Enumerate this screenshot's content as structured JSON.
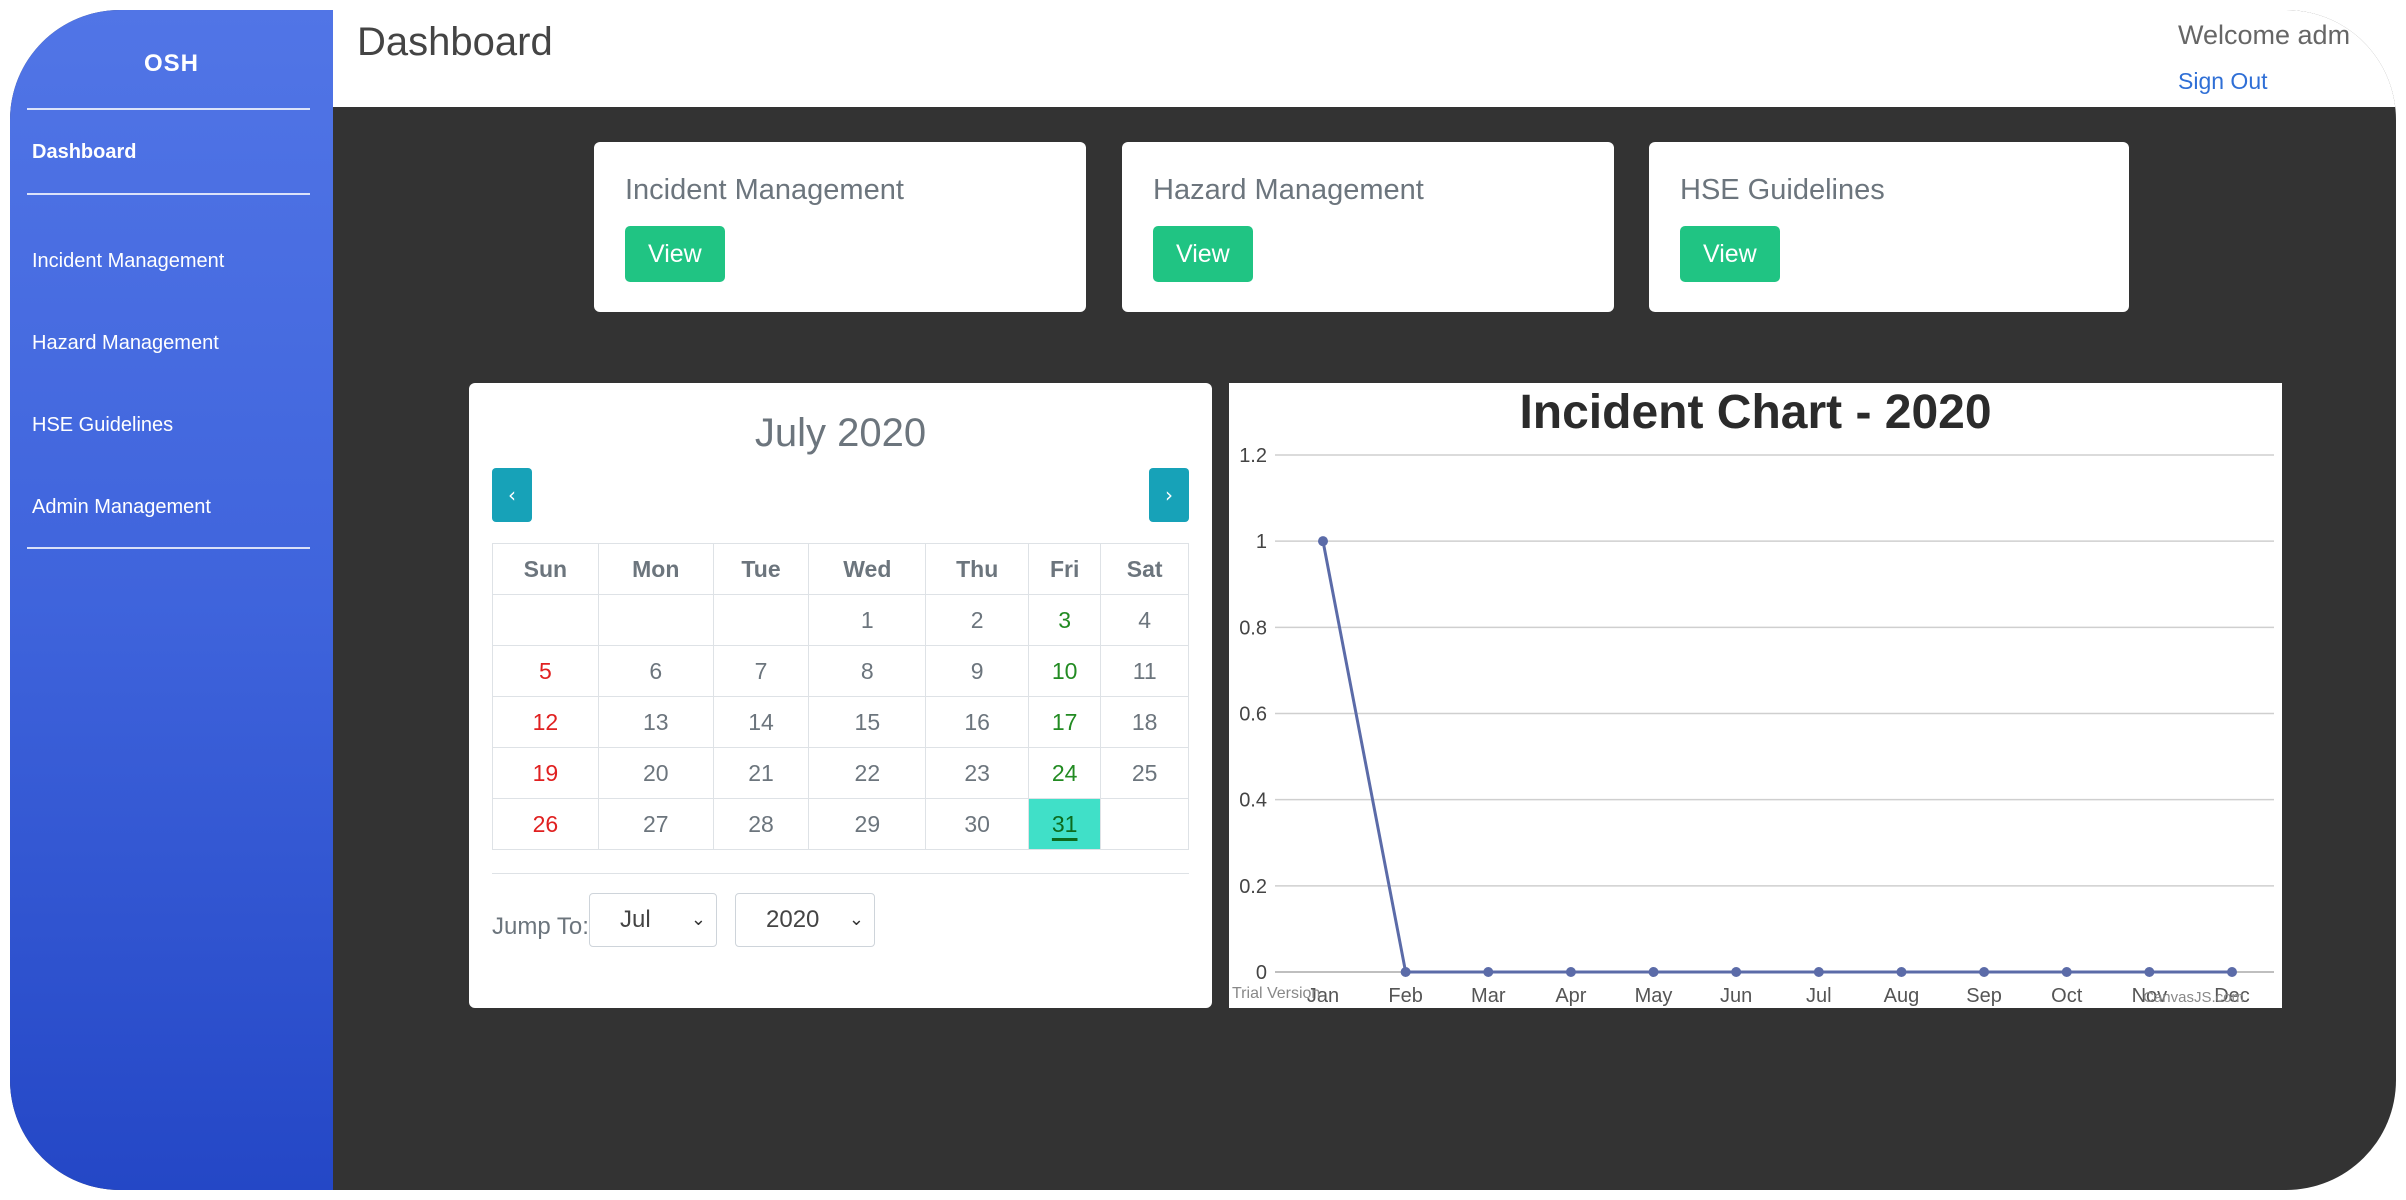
{
  "sidebar": {
    "brand": "OSH",
    "items": [
      {
        "label": "Dashboard"
      },
      {
        "label": "Incident Management"
      },
      {
        "label": "Hazard Management"
      },
      {
        "label": "HSE Guidelines"
      },
      {
        "label": "Admin Management"
      }
    ]
  },
  "header": {
    "title": "Dashboard",
    "welcome": "Welcome adm",
    "sign_out": "Sign Out"
  },
  "cards": [
    {
      "title": "Incident Management",
      "button": "View"
    },
    {
      "title": "Hazard Management",
      "button": "View"
    },
    {
      "title": "HSE Guidelines",
      "button": "View"
    }
  ],
  "calendar": {
    "title": "July 2020",
    "prev": "‹",
    "next": "›",
    "weekdays": [
      "Sun",
      "Mon",
      "Tue",
      "Wed",
      "Thu",
      "Fri",
      "Sat"
    ],
    "weeks": [
      [
        "",
        "",
        "",
        "1",
        "2",
        "3",
        "4"
      ],
      [
        "5",
        "6",
        "7",
        "8",
        "9",
        "10",
        "11"
      ],
      [
        "12",
        "13",
        "14",
        "15",
        "16",
        "17",
        "18"
      ],
      [
        "19",
        "20",
        "21",
        "22",
        "23",
        "24",
        "25"
      ],
      [
        "26",
        "27",
        "28",
        "29",
        "30",
        "31",
        ""
      ]
    ],
    "today": "31",
    "jump_label": "Jump To:",
    "month_selected": "Jul",
    "year_selected": "2020",
    "colors": {
      "sunday": "#e02020",
      "friday": "#228b22",
      "today_bg": "#40e0c8"
    }
  },
  "chart_data": {
    "type": "line",
    "title": "Incident Chart - 2020",
    "categories": [
      "Jan",
      "Feb",
      "Mar",
      "Apr",
      "May",
      "Jun",
      "Jul",
      "Aug",
      "Sep",
      "Oct",
      "Nov",
      "Dec"
    ],
    "series": [
      {
        "values": [
          1,
          0,
          0,
          0,
          0,
          0,
          0,
          0,
          0,
          0,
          0,
          0
        ]
      }
    ],
    "ylim": [
      0,
      1.2
    ],
    "yticks": [
      "0",
      "0.2",
      "0.4",
      "0.6",
      "0.8",
      "1",
      "1.2"
    ],
    "grid": true,
    "line_color": "#5b6ba8",
    "watermark_left": "Trial Version",
    "watermark_right": "CanvasJS.com"
  }
}
